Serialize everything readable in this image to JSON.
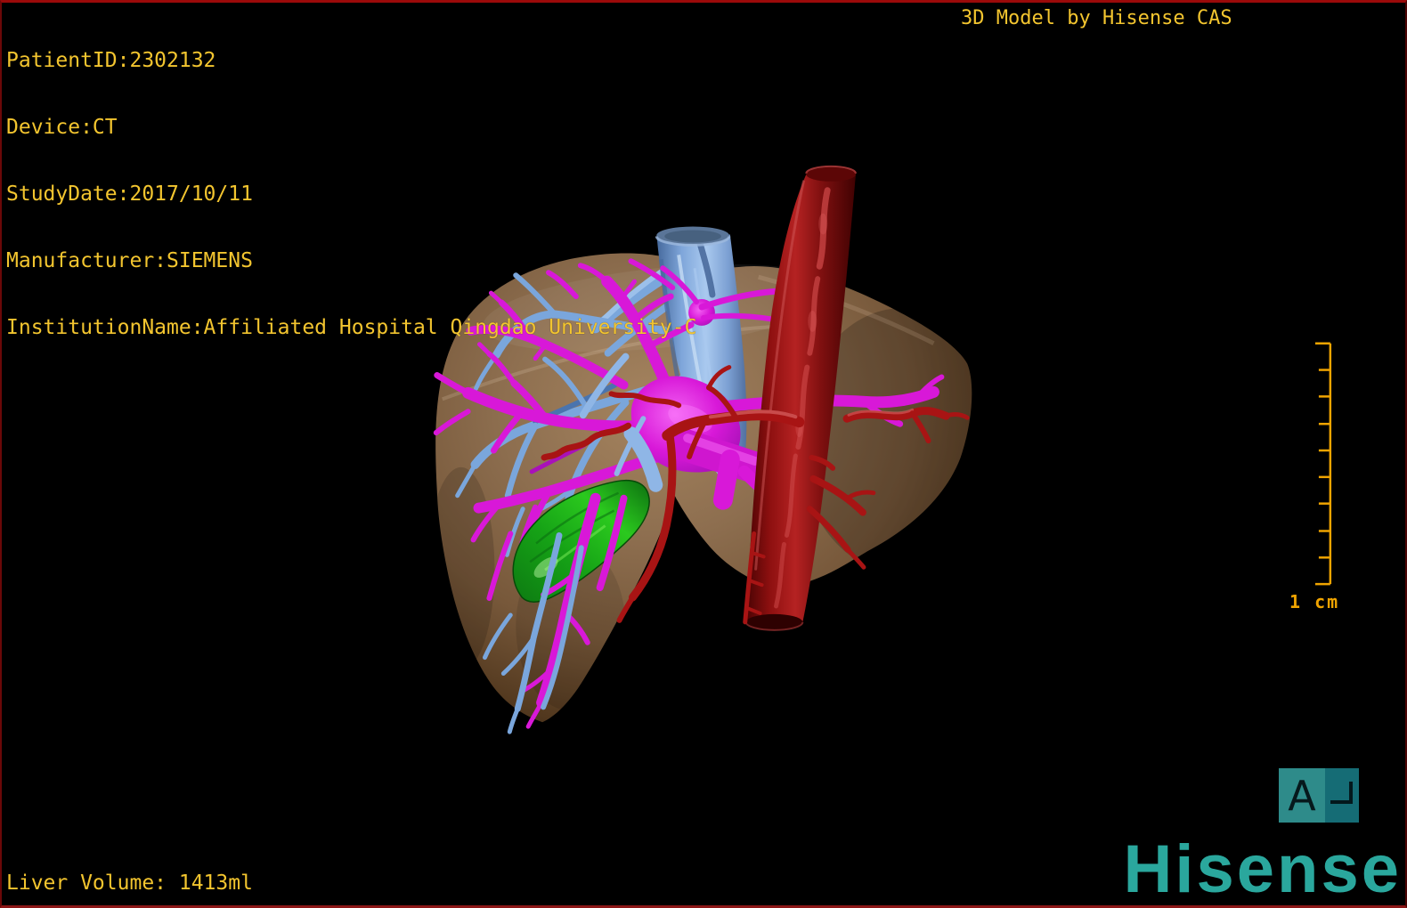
{
  "overlay": {
    "patient_info": [
      "PatientID:2302132",
      "Device:CT",
      "StudyDate:2017/10/11",
      "Manufacturer:SIEMENS",
      "InstitutionName:Affiliated Hospital Qingdao University-C"
    ],
    "watermark": "3D Model by Hisense CAS",
    "liver_volume": "Liver Volume: 1413ml",
    "scale_label": "1 cm",
    "orientation_marker": "A",
    "brand": "Hisense"
  },
  "colors": {
    "text_yellow": "#f3c52f",
    "ruler_yellow": "#f0a400",
    "brand_teal": "#2aa79d",
    "marker_teal_left": "#2e8b8a",
    "marker_teal_right": "#156c75",
    "border_red": "#8b1010",
    "liver_tan": "#8a6b4e",
    "portal_vein_magenta": "#d818d8",
    "hepatic_vein_blue": "#7aa6dc",
    "vena_cava_blue": "#8fb6e6",
    "artery_red": "#a81414",
    "gallbladder_green": "#16a316"
  },
  "structures": [
    {
      "name": "liver-parenchyma",
      "color": "#8a6b4e"
    },
    {
      "name": "portal-vein",
      "color": "#d818d8"
    },
    {
      "name": "hepatic-veins",
      "color": "#7aa6dc"
    },
    {
      "name": "inferior-vena-cava",
      "color": "#8fb6e6"
    },
    {
      "name": "aorta-and-hepatic-artery",
      "color": "#a81414"
    },
    {
      "name": "gallbladder",
      "color": "#16a316"
    }
  ]
}
